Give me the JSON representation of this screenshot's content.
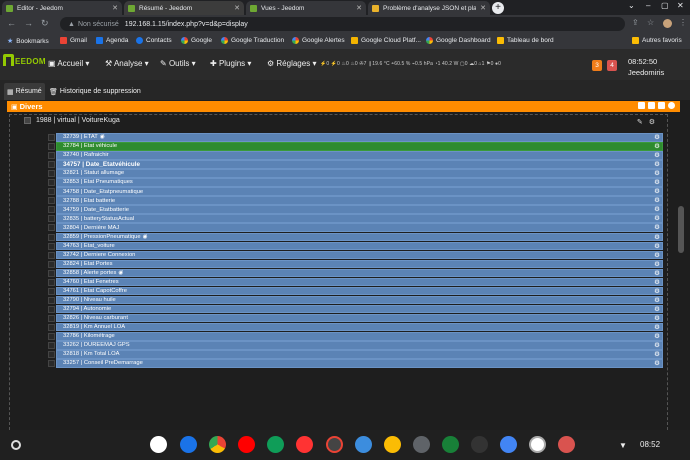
{
  "browser": {
    "tabs": [
      {
        "label": "Editor - Jeedom",
        "active": false
      },
      {
        "label": "Résumé - Jeedom",
        "active": true
      },
      {
        "label": "Vues - Jeedom",
        "active": false
      },
      {
        "label": "Problème d'analyse JSON et pla",
        "active": false
      }
    ],
    "nav_back": "←",
    "nav_forward": "→",
    "nav_reload": "↻",
    "security_icon": "▲",
    "security_label": "Non sécurisé",
    "url": "192.168.1.15/index.php?v=d&p=display",
    "window_min": "–",
    "window_max": "▢",
    "window_close": "✕",
    "new_tab": "+",
    "bookmarks": [
      {
        "label": "Bookmarks",
        "icon": "star-icon"
      },
      {
        "label": "Gmail",
        "icon": "gmail-icon"
      },
      {
        "label": "Agenda",
        "icon": "calendar-icon"
      },
      {
        "label": "Contacts",
        "icon": "contacts-icon"
      },
      {
        "label": "Google",
        "icon": "google-icon"
      },
      {
        "label": "Google Traduction",
        "icon": "google-icon"
      },
      {
        "label": "Google Alertes",
        "icon": "google-icon"
      },
      {
        "label": "Google Cloud Platf...",
        "icon": "google-cloud-icon"
      },
      {
        "label": "Google Dashboard",
        "icon": "google-icon"
      },
      {
        "label": "Tableau de bord",
        "icon": "dashboard-icon"
      }
    ],
    "other_bookmarks": "Autres favoris"
  },
  "jeedom": {
    "logo_text": "EEDOM",
    "menu": {
      "accueil": "Accueil",
      "analyse": "Analyse",
      "outils": "Outils",
      "plugins": "Plugins",
      "reglages": "Réglages"
    },
    "widgets_text": "⚡0  ⚡0  ♨0  ♨0  ✇7  ❙19.6 °C  ◓60.5 %  ⌁0.5 hPa  ◔1 40.2 W  ▢0 ☁0 ⌂1 ⚑0 ●0",
    "badge_orange": "3",
    "badge_red": "4",
    "time": "08:52:50",
    "user": "Jeedomiris",
    "subtabs": {
      "resume": "Résumé",
      "history": "Historique de suppression"
    },
    "section": "Divers",
    "object": "1988 | virtual | VoitureKuga",
    "rows": [
      {
        "text": "32739 | ETAT",
        "bold": false,
        "eye": true,
        "highlight": false
      },
      {
        "text": "32784 | Etat véhicule",
        "bold": false,
        "eye": false,
        "highlight": true
      },
      {
        "text": "32740 | Rafraichir",
        "bold": false,
        "eye": false,
        "highlight": false
      },
      {
        "text": "34757 | Date_Etatvéhicule",
        "bold": true,
        "eye": false,
        "highlight": false
      },
      {
        "text": "32821 | Statut allumage",
        "bold": false,
        "eye": false,
        "highlight": false
      },
      {
        "text": "32853 | Etat Pneumatiques",
        "bold": false,
        "eye": false,
        "highlight": false
      },
      {
        "text": "34758 | Date_Etatpneumatique",
        "bold": false,
        "eye": false,
        "highlight": false
      },
      {
        "text": "32788 | Etat batterie",
        "bold": false,
        "eye": false,
        "highlight": false
      },
      {
        "text": "34759 | Date_Etatbatterie",
        "bold": false,
        "eye": false,
        "highlight": false
      },
      {
        "text": "32835 | batteryStatusActual",
        "bold": false,
        "eye": false,
        "highlight": false
      },
      {
        "text": "32804 | Dernière MAJ",
        "bold": false,
        "eye": false,
        "highlight": false
      },
      {
        "text": "32859 | PressionPneumatique",
        "bold": false,
        "eye": true,
        "highlight": false
      },
      {
        "text": "34763 | Etat_voiture",
        "bold": false,
        "eye": false,
        "highlight": false
      },
      {
        "text": "32742 | Derniere Connexion",
        "bold": false,
        "eye": false,
        "highlight": false
      },
      {
        "text": "32824 | Etat Portes",
        "bold": false,
        "eye": false,
        "highlight": false
      },
      {
        "text": "32858 | Alerte portes",
        "bold": false,
        "eye": true,
        "highlight": false
      },
      {
        "text": "34760 | Etat Fenetres",
        "bold": false,
        "eye": false,
        "highlight": false
      },
      {
        "text": "34761 | Etat CapotCoffre",
        "bold": false,
        "eye": false,
        "highlight": false
      },
      {
        "text": "32790 | Niveau huile",
        "bold": false,
        "eye": false,
        "highlight": false
      },
      {
        "text": "32794 | Autonomie",
        "bold": false,
        "eye": false,
        "highlight": false
      },
      {
        "text": "32826 | Niveau carburant",
        "bold": false,
        "eye": false,
        "highlight": false
      },
      {
        "text": "32819 | Km Annuel LOA",
        "bold": false,
        "eye": false,
        "highlight": false
      },
      {
        "text": "32786 | Kilométrage",
        "bold": false,
        "eye": false,
        "highlight": false
      },
      {
        "text": "33262 | DUREEMAJ GPS",
        "bold": false,
        "eye": false,
        "highlight": false
      },
      {
        "text": "32818 | Km Total LOA",
        "bold": false,
        "eye": false,
        "highlight": false
      },
      {
        "text": "33257 | Conseil PreDemarrage",
        "bold": false,
        "eye": false,
        "highlight": false
      }
    ]
  },
  "shelf": {
    "time": "08:52"
  },
  "colors": {
    "accent_orange": "#ff8c00",
    "row_blue": "#5b83b5",
    "row_green": "#2e8b2e",
    "jeedom_green": "#94ca02"
  }
}
